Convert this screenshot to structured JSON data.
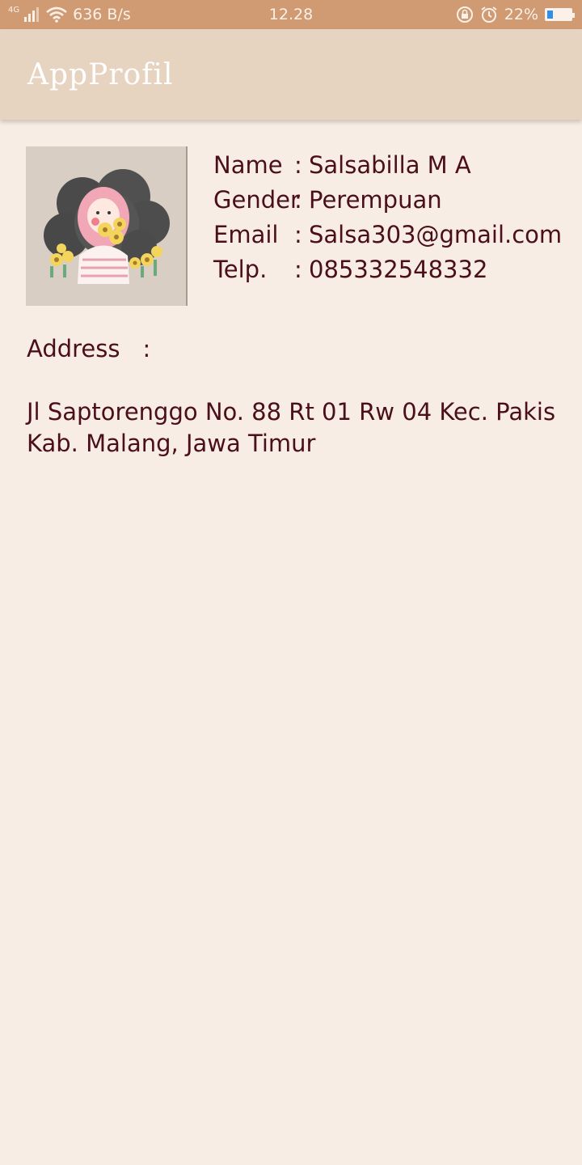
{
  "status_bar": {
    "network_type": "4G",
    "speed": "636 B/s",
    "time": "12.28",
    "battery_percent": "22%",
    "battery_level": 0.22,
    "icons": [
      "signal-icon",
      "wifi-icon",
      "rotation-lock-icon",
      "alarm-icon",
      "battery-icon"
    ]
  },
  "appbar": {
    "title": "AppProfil"
  },
  "profile": {
    "name_label": "Name",
    "name_value": "Salsabilla M A",
    "gender_label": "Gender",
    "gender_value": "Perempuan",
    "email_label": "Email",
    "email_value": "Salsa303@gmail.com",
    "phone_label": "Telp.",
    "phone_value": "085332548332",
    "separator": ":"
  },
  "address": {
    "label": "Address",
    "separator": ":",
    "value": "Jl Saptorenggo No. 88 Rt 01 Rw 04 Kec. Pakis Kab. Malang, Jawa Timur"
  },
  "colors": {
    "status_bar": "#d09a72",
    "app_bar": "#e6d3c0",
    "background": "#f7ede4",
    "text": "#4a0f1a"
  }
}
